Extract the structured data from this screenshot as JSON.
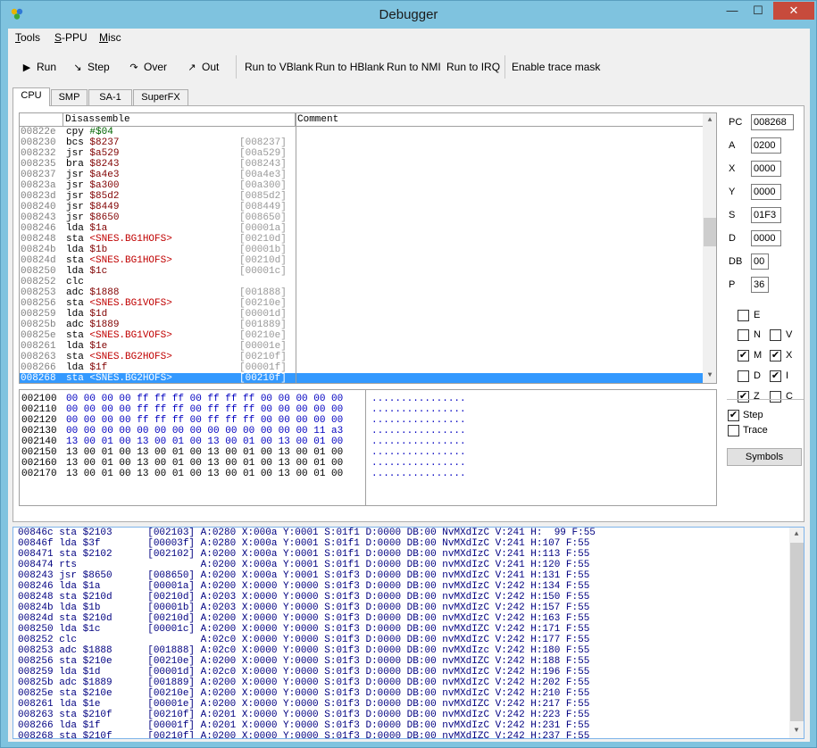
{
  "window": {
    "title": "Debugger",
    "min": "—",
    "max": "☐",
    "close": "✕"
  },
  "menu": [
    {
      "accel": "T",
      "rest": "ools"
    },
    {
      "accel": "S",
      "rest": "-PPU"
    },
    {
      "accel": "M",
      "rest": "isc"
    }
  ],
  "toolbar": {
    "run": "Run",
    "step": "Step",
    "over": "Over",
    "out": "Out",
    "run_vblank": "Run to VBlank",
    "run_hblank": "Run to HBlank",
    "run_nmi": "Run to NMI",
    "run_irq": "Run to IRQ",
    "trace_mask": "Enable trace mask"
  },
  "tabs": [
    "CPU",
    "SMP",
    "SA-1",
    "SuperFX"
  ],
  "disassembly": {
    "headers": [
      "",
      "Disassemble",
      "Comment"
    ],
    "rows": [
      {
        "addr": "00822e",
        "op": "cpy",
        "arg": "#$04",
        "kind": "imm",
        "target": ""
      },
      {
        "addr": "008230",
        "op": "bcs",
        "arg": "$8237",
        "kind": "num",
        "target": "[008237]"
      },
      {
        "addr": "008232",
        "op": "jsr",
        "arg": "$a529",
        "kind": "num",
        "target": "[00a529]"
      },
      {
        "addr": "008235",
        "op": "bra",
        "arg": "$8243",
        "kind": "num",
        "target": "[008243]"
      },
      {
        "addr": "008237",
        "op": "jsr",
        "arg": "$a4e3",
        "kind": "num",
        "target": "[00a4e3]"
      },
      {
        "addr": "00823a",
        "op": "jsr",
        "arg": "$a300",
        "kind": "num",
        "target": "[00a300]"
      },
      {
        "addr": "00823d",
        "op": "jsr",
        "arg": "$85d2",
        "kind": "num",
        "target": "[0085d2]"
      },
      {
        "addr": "008240",
        "op": "jsr",
        "arg": "$8449",
        "kind": "num",
        "target": "[008449]"
      },
      {
        "addr": "008243",
        "op": "jsr",
        "arg": "$8650",
        "kind": "num",
        "target": "[008650]"
      },
      {
        "addr": "008246",
        "op": "lda",
        "arg": "$1a",
        "kind": "num",
        "target": "[00001a]"
      },
      {
        "addr": "008248",
        "op": "sta",
        "arg": "<SNES.BG1HOFS>",
        "kind": "lbl",
        "target": "[00210d]"
      },
      {
        "addr": "00824b",
        "op": "lda",
        "arg": "$1b",
        "kind": "num",
        "target": "[00001b]"
      },
      {
        "addr": "00824d",
        "op": "sta",
        "arg": "<SNES.BG1HOFS>",
        "kind": "lbl",
        "target": "[00210d]"
      },
      {
        "addr": "008250",
        "op": "lda",
        "arg": "$1c",
        "kind": "num",
        "target": "[00001c]"
      },
      {
        "addr": "008252",
        "op": "clc",
        "arg": "",
        "kind": "num",
        "target": ""
      },
      {
        "addr": "008253",
        "op": "adc",
        "arg": "$1888",
        "kind": "num",
        "target": "[001888]"
      },
      {
        "addr": "008256",
        "op": "sta",
        "arg": "<SNES.BG1VOFS>",
        "kind": "lbl",
        "target": "[00210e]"
      },
      {
        "addr": "008259",
        "op": "lda",
        "arg": "$1d",
        "kind": "num",
        "target": "[00001d]"
      },
      {
        "addr": "00825b",
        "op": "adc",
        "arg": "$1889",
        "kind": "num",
        "target": "[001889]"
      },
      {
        "addr": "00825e",
        "op": "sta",
        "arg": "<SNES.BG1VOFS>",
        "kind": "lbl",
        "target": "[00210e]"
      },
      {
        "addr": "008261",
        "op": "lda",
        "arg": "$1e",
        "kind": "num",
        "target": "[00001e]"
      },
      {
        "addr": "008263",
        "op": "sta",
        "arg": "<SNES.BG2HOFS>",
        "kind": "lbl",
        "target": "[00210f]"
      },
      {
        "addr": "008266",
        "op": "lda",
        "arg": "$1f",
        "kind": "num",
        "target": "[00001f]"
      },
      {
        "addr": "008268",
        "op": "sta",
        "arg": "<SNES.BG2HOFS>",
        "kind": "lbl",
        "target": "[00210f]",
        "selected": true
      }
    ]
  },
  "memory": {
    "rows": [
      {
        "addr": "002100",
        "bytes": "00 00 00 00 ff ff ff 00 ff ff ff 00 00 00 00 00",
        "ascii": "................",
        "color": "#0000c0"
      },
      {
        "addr": "002110",
        "bytes": "00 00 00 00 ff ff ff 00 ff ff ff 00 00 00 00 00",
        "ascii": "................",
        "color": "#0000c0"
      },
      {
        "addr": "002120",
        "bytes": "00 00 00 00 ff ff ff 00 ff ff ff 00 00 00 00 00",
        "ascii": "................",
        "color": "#0000c0"
      },
      {
        "addr": "002130",
        "bytes": "00 00 00 00 00 00 00 00 00 00 00 00 00 00 11 a3",
        "ascii": "................",
        "color": "#0000c0"
      },
      {
        "addr": "002140",
        "bytes": "13 00 01 00 13 00 01 00 13 00 01 00 13 00 01 00",
        "ascii": "................",
        "color": "#0000c0"
      },
      {
        "addr": "002150",
        "bytes": "13 00 01 00 13 00 01 00 13 00 01 00 13 00 01 00",
        "ascii": "................",
        "color": "#000000"
      },
      {
        "addr": "002160",
        "bytes": "13 00 01 00 13 00 01 00 13 00 01 00 13 00 01 00",
        "ascii": "................",
        "color": "#000000"
      },
      {
        "addr": "002170",
        "bytes": "13 00 01 00 13 00 01 00 13 00 01 00 13 00 01 00",
        "ascii": "................",
        "color": "#000000"
      }
    ]
  },
  "registers": [
    {
      "name": "PC",
      "value": "008268"
    },
    {
      "name": "A",
      "value": "0200"
    },
    {
      "name": "X",
      "value": "0000"
    },
    {
      "name": "Y",
      "value": "0000"
    },
    {
      "name": "S",
      "value": "01F3"
    },
    {
      "name": "D",
      "value": "0000"
    },
    {
      "name": "DB",
      "value": "00"
    },
    {
      "name": "P",
      "value": "36"
    }
  ],
  "flags": [
    {
      "name": "E",
      "checked": false
    },
    {
      "name": "N",
      "checked": false
    },
    {
      "name": "V",
      "checked": false
    },
    {
      "name": "M",
      "checked": true
    },
    {
      "name": "X",
      "checked": true
    },
    {
      "name": "D",
      "checked": false
    },
    {
      "name": "I",
      "checked": true
    },
    {
      "name": "Z",
      "checked": true
    },
    {
      "name": "C",
      "checked": false
    }
  ],
  "options": [
    {
      "name": "Step",
      "checked": true
    },
    {
      "name": "Trace",
      "checked": false
    }
  ],
  "symbols_label": "Symbols",
  "trace": [
    "00846c sta $2103      [002103] A:0280 X:000a Y:0001 S:01f1 D:0000 DB:00 NvMXdIzC V:241 H:  99 F:55",
    "00846f lda $3f        [00003f] A:0280 X:000a Y:0001 S:01f1 D:0000 DB:00 NvMXdIzC V:241 H:107 F:55",
    "008471 sta $2102      [002102] A:0200 X:000a Y:0001 S:01f1 D:0000 DB:00 nvMXdIzC V:241 H:113 F:55",
    "008474 rts                     A:0200 X:000a Y:0001 S:01f1 D:0000 DB:00 nvMXdIzC V:241 H:120 F:55",
    "008243 jsr $8650      [008650] A:0200 X:000a Y:0001 S:01f3 D:0000 DB:00 nvMXdIzC V:241 H:131 F:55",
    "008246 lda $1a        [00001a] A:0200 X:0000 Y:0000 S:01f3 D:0000 DB:00 nvMXdIzC V:242 H:134 F:55",
    "008248 sta $210d      [00210d] A:0203 X:0000 Y:0000 S:01f3 D:0000 DB:00 nvMXdIzC V:242 H:150 F:55",
    "00824b lda $1b        [00001b] A:0203 X:0000 Y:0000 S:01f3 D:0000 DB:00 nvMXdIzC V:242 H:157 F:55",
    "00824d sta $210d      [00210d] A:0200 X:0000 Y:0000 S:01f3 D:0000 DB:00 nvMXdIzC V:242 H:163 F:55",
    "008250 lda $1c        [00001c] A:0200 X:0000 Y:0000 S:01f3 D:0000 DB:00 nvMXdIZC V:242 H:171 F:55",
    "008252 clc                     A:02c0 X:0000 Y:0000 S:01f3 D:0000 DB:00 nvMXdIzC V:242 H:177 F:55",
    "008253 adc $1888      [001888] A:02c0 X:0000 Y:0000 S:01f3 D:0000 DB:00 nvMXdIzc V:242 H:180 F:55",
    "008256 sta $210e      [00210e] A:0200 X:0000 Y:0000 S:01f3 D:0000 DB:00 nvMXdIZC V:242 H:188 F:55",
    "008259 lda $1d        [00001d] A:02c0 X:0000 Y:0000 S:01f3 D:0000 DB:00 nvMXdIzC V:242 H:196 F:55",
    "00825b adc $1889      [001889] A:0200 X:0000 Y:0000 S:01f3 D:0000 DB:00 nvMXdIzC V:242 H:202 F:55",
    "00825e sta $210e      [00210e] A:0200 X:0000 Y:0000 S:01f3 D:0000 DB:00 nvMXdIzC V:242 H:210 F:55",
    "008261 lda $1e        [00001e] A:0200 X:0000 Y:0000 S:01f3 D:0000 DB:00 nvMXdIZC V:242 H:217 F:55",
    "008263 sta $210f      [00210f] A:0201 X:0000 Y:0000 S:01f3 D:0000 DB:00 nvMXdIzC V:242 H:223 F:55",
    "008266 lda $1f        [00001f] A:0201 X:0000 Y:0000 S:01f3 D:0000 DB:00 nvMXdIzC V:242 H:231 F:55",
    "008268 sta $210f      [00210f] A:0200 X:0000 Y:0000 S:01f3 D:0000 DB:00 nvMXdIZC V:242 H:237 F:55"
  ]
}
